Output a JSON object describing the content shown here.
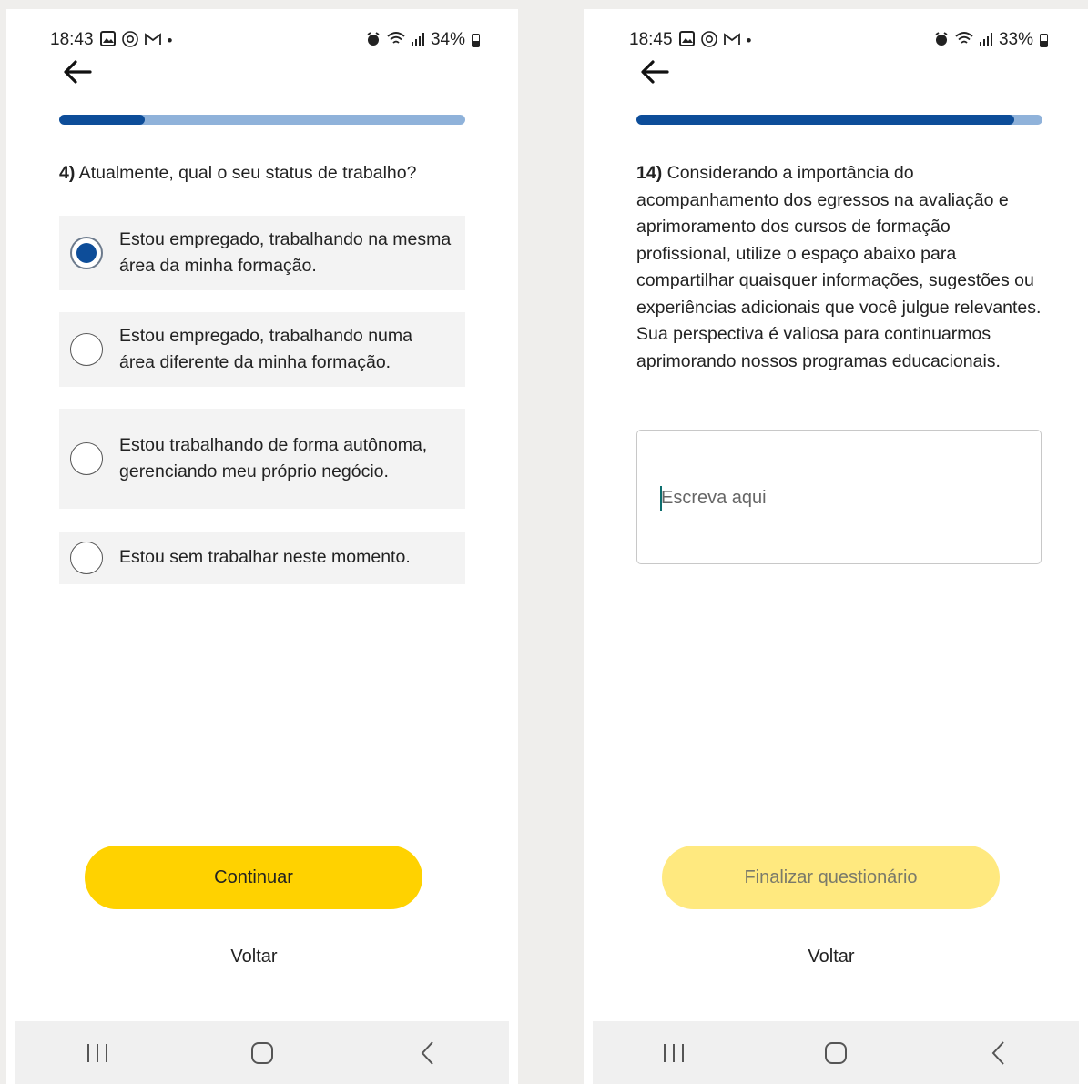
{
  "screens": [
    {
      "status": {
        "time": "18:43",
        "battery": "34%"
      },
      "progress": 0.21,
      "question": {
        "number": "4)",
        "text": " Atualmente, qual o seu status de trabalho?"
      },
      "options": [
        {
          "label": "Estou empregado, trabalhando na mesma área da minha formação.",
          "selected": true
        },
        {
          "label": "Estou empregado, trabalhando numa área diferente da minha formação.",
          "selected": false
        },
        {
          "label": "Estou trabalhando de forma autônoma, gerenciando meu próprio negócio.",
          "selected": false
        },
        {
          "label": "Estou sem trabalhar neste momento.",
          "selected": false
        }
      ],
      "primary_button": "Continuar",
      "secondary_button": "Voltar"
    },
    {
      "status": {
        "time": "18:45",
        "battery": "33%"
      },
      "progress": 0.93,
      "question": {
        "number": "14)",
        "text": " Considerando a importância do acompanhamento dos egressos na avaliação e aprimoramento dos cursos de formação profissional, utilize o espaço abaixo para compartilhar quaisquer informações, sugestões ou experiências adicionais que você julgue relevantes. Sua perspectiva é valiosa para continuarmos aprimorando nossos programas educacionais."
      },
      "input": {
        "placeholder": "Escreva aqui",
        "value": ""
      },
      "primary_button": "Finalizar questionário",
      "secondary_button": "Voltar"
    }
  ],
  "colors": {
    "accent_blue": "#0d4d99",
    "progress_track": "#8fb2da",
    "button_yellow": "#ffd200",
    "button_yellow_disabled": "#ffe97f"
  },
  "icons": {
    "back": "arrow-left-icon",
    "nav_recents": "recents-icon",
    "nav_home": "home-icon",
    "nav_back": "chevron-left-icon"
  }
}
